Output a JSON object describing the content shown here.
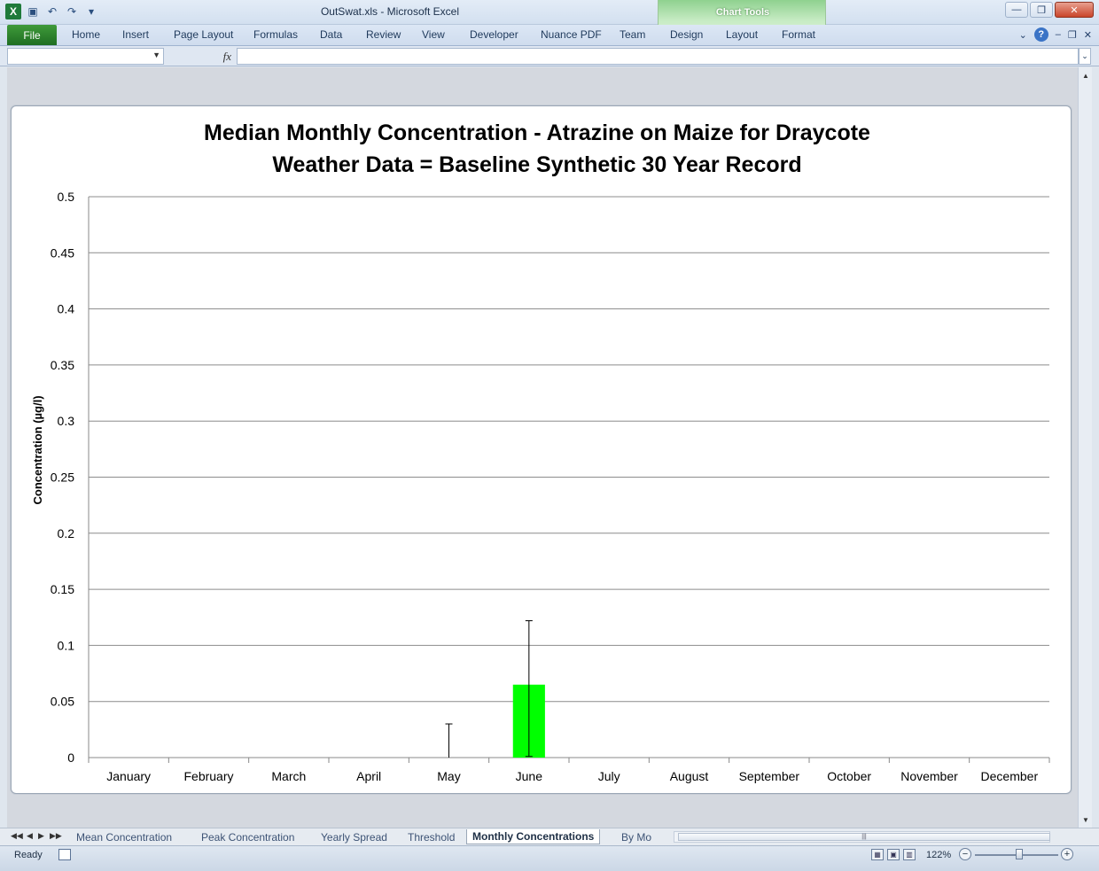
{
  "window": {
    "title": "OutSwat.xls  -  Microsoft Excel",
    "contextual_group": "Chart Tools"
  },
  "ribbon": {
    "file_label": "File",
    "tabs": [
      "Home",
      "Insert",
      "Page Layout",
      "Formulas",
      "Data",
      "Review",
      "View",
      "Developer",
      "Nuance PDF",
      "Team",
      "Design",
      "Layout",
      "Format"
    ]
  },
  "formula_bar": {
    "name_box": "",
    "fx_label": "fx",
    "formula": ""
  },
  "chart_data": {
    "type": "bar",
    "title": "Median Monthly Concentration - Atrazine on Maize for Draycote",
    "subtitle": "Weather Data = Baseline Synthetic 30 Year Record",
    "xlabel": "",
    "ylabel": "Concentration (µg/l)",
    "ylim": [
      0,
      0.5
    ],
    "yticks": [
      "0",
      "0.05",
      "0.1",
      "0.15",
      "0.2",
      "0.25",
      "0.3",
      "0.35",
      "0.4",
      "0.45",
      "0.5"
    ],
    "categories": [
      "January",
      "February",
      "March",
      "April",
      "May",
      "June",
      "July",
      "August",
      "September",
      "October",
      "November",
      "December"
    ],
    "values": [
      0,
      0,
      0,
      0,
      0,
      0.065,
      0,
      0,
      0,
      0,
      0,
      0
    ],
    "error_low": [
      0,
      0,
      0,
      0,
      0,
      0.001,
      0,
      0,
      0,
      0,
      0,
      0
    ],
    "error_high": [
      0,
      0,
      0,
      0,
      0.03,
      0.122,
      0,
      0,
      0,
      0,
      0,
      0
    ],
    "bar_color": "#00ff00",
    "grid": true,
    "legend": "none"
  },
  "sheet_tabs": {
    "tabs": [
      "Mean Concentration",
      "Peak Concentration",
      "Yearly Spread",
      "Threshold",
      "Monthly Concentrations",
      "By Mo"
    ],
    "active": "Monthly Concentrations"
  },
  "status_bar": {
    "status": "Ready",
    "zoom": "122%"
  },
  "colors": {
    "file_tab": "#2a7d2e",
    "chart_tools": "#9fd89a",
    "bar": "#00ff00"
  }
}
